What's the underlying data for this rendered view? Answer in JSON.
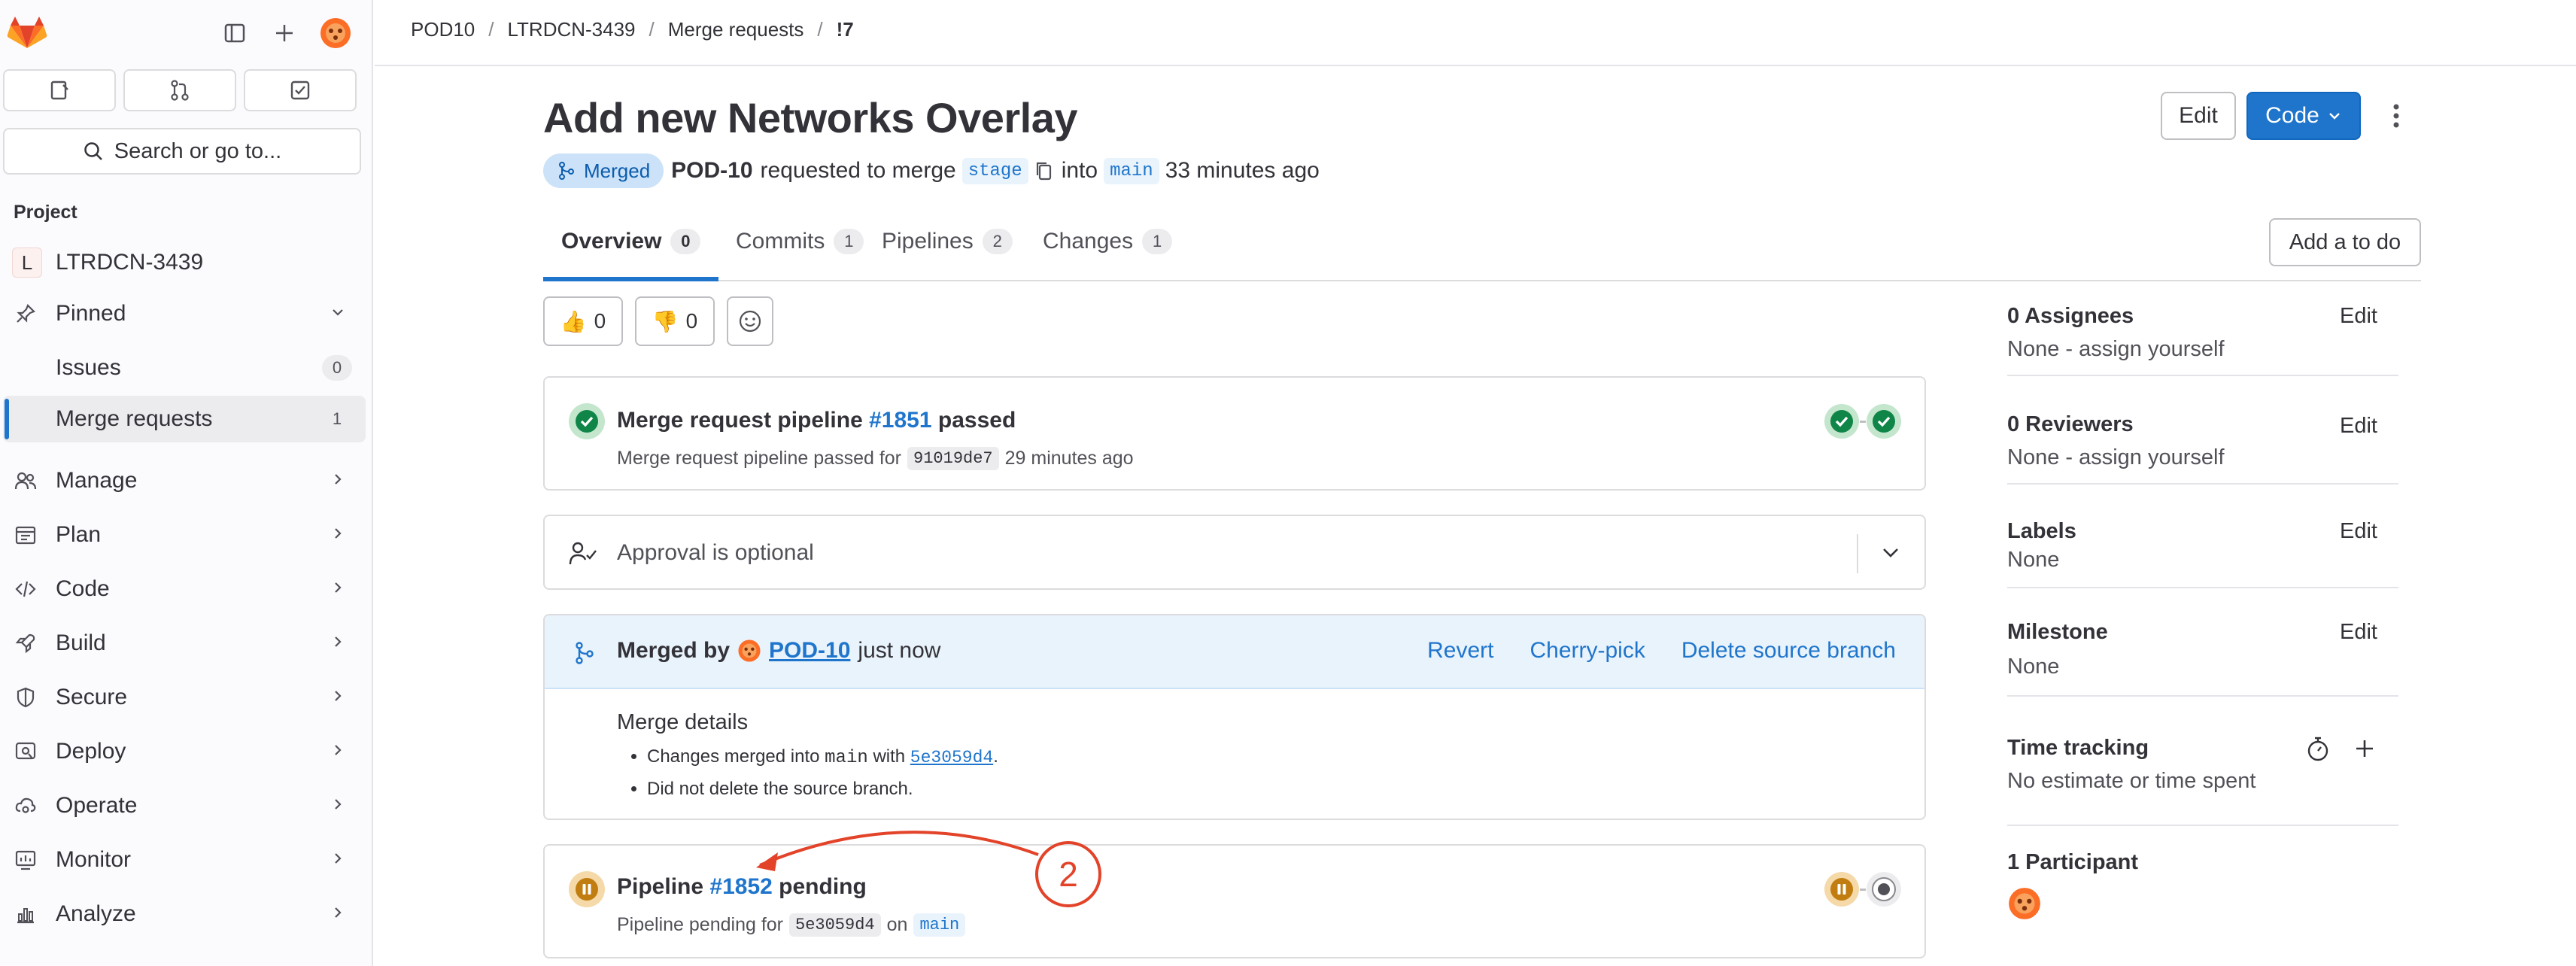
{
  "sidebar": {
    "search_label": "Search or go to...",
    "section_title": "Project",
    "project": {
      "initial": "L",
      "name": "LTRDCN-3439"
    },
    "pinned_label": "Pinned",
    "pinned_items": [
      {
        "label": "Issues",
        "count": "0"
      },
      {
        "label": "Merge requests",
        "count": "1"
      }
    ],
    "nav_items": [
      "Manage",
      "Plan",
      "Code",
      "Build",
      "Secure",
      "Deploy",
      "Operate",
      "Monitor",
      "Analyze"
    ]
  },
  "breadcrumbs": [
    "POD10",
    "LTRDCN-3439",
    "Merge requests",
    "!7"
  ],
  "mr": {
    "title": "Add new Networks Overlay",
    "status_badge": "Merged",
    "author": "POD-10",
    "requested_text": "requested to merge",
    "source_branch": "stage",
    "into_text": "into",
    "target_branch": "main",
    "time_ago": "33 minutes ago"
  },
  "header_buttons": {
    "edit": "Edit",
    "code": "Code"
  },
  "tabs": [
    {
      "label": "Overview",
      "count": "0"
    },
    {
      "label": "Commits",
      "count": "1"
    },
    {
      "label": "Pipelines",
      "count": "2"
    },
    {
      "label": "Changes",
      "count": "1"
    }
  ],
  "todo_button": "Add a to do",
  "reactions": {
    "thumbs_up": "0",
    "thumbs_down": "0"
  },
  "pipeline_card": {
    "title_prefix": "Merge request pipeline",
    "pipeline_id": "#1851",
    "status": "passed",
    "sub_prefix": "Merge request pipeline passed for",
    "sha": "91019de7",
    "sub_time": "29 minutes ago"
  },
  "approval": {
    "text": "Approval is optional"
  },
  "merged_card": {
    "merged_by": "Merged by",
    "user": "POD-10",
    "when": "just now",
    "actions": [
      "Revert",
      "Cherry-pick",
      "Delete source branch"
    ],
    "details_title": "Merge details",
    "detail1_prefix": "Changes merged into",
    "detail1_branch": "main",
    "detail1_with": "with",
    "detail1_sha": "5e3059d4",
    "detail2": "Did not delete the source branch."
  },
  "pipeline2_card": {
    "title_prefix": "Pipeline",
    "pipeline_id": "#1852",
    "status": "pending",
    "sub_prefix": "Pipeline pending for",
    "sha": "5e3059d4",
    "on_text": "on",
    "branch": "main"
  },
  "right_sidebar": {
    "assignees_title": "0 Assignees",
    "assignees_value": "None - assign yourself",
    "reviewers_title": "0 Reviewers",
    "reviewers_value": "None - assign yourself",
    "labels_title": "Labels",
    "labels_value": "None",
    "milestone_title": "Milestone",
    "milestone_value": "None",
    "time_title": "Time tracking",
    "time_value": "No estimate or time spent",
    "participants_title": "1 Participant",
    "edit_label": "Edit"
  },
  "annotation": {
    "number": "2"
  },
  "colors": {
    "accent": "#1f75cb",
    "success": "#108548",
    "warning": "#c17d10",
    "annotation": "#e24329"
  }
}
